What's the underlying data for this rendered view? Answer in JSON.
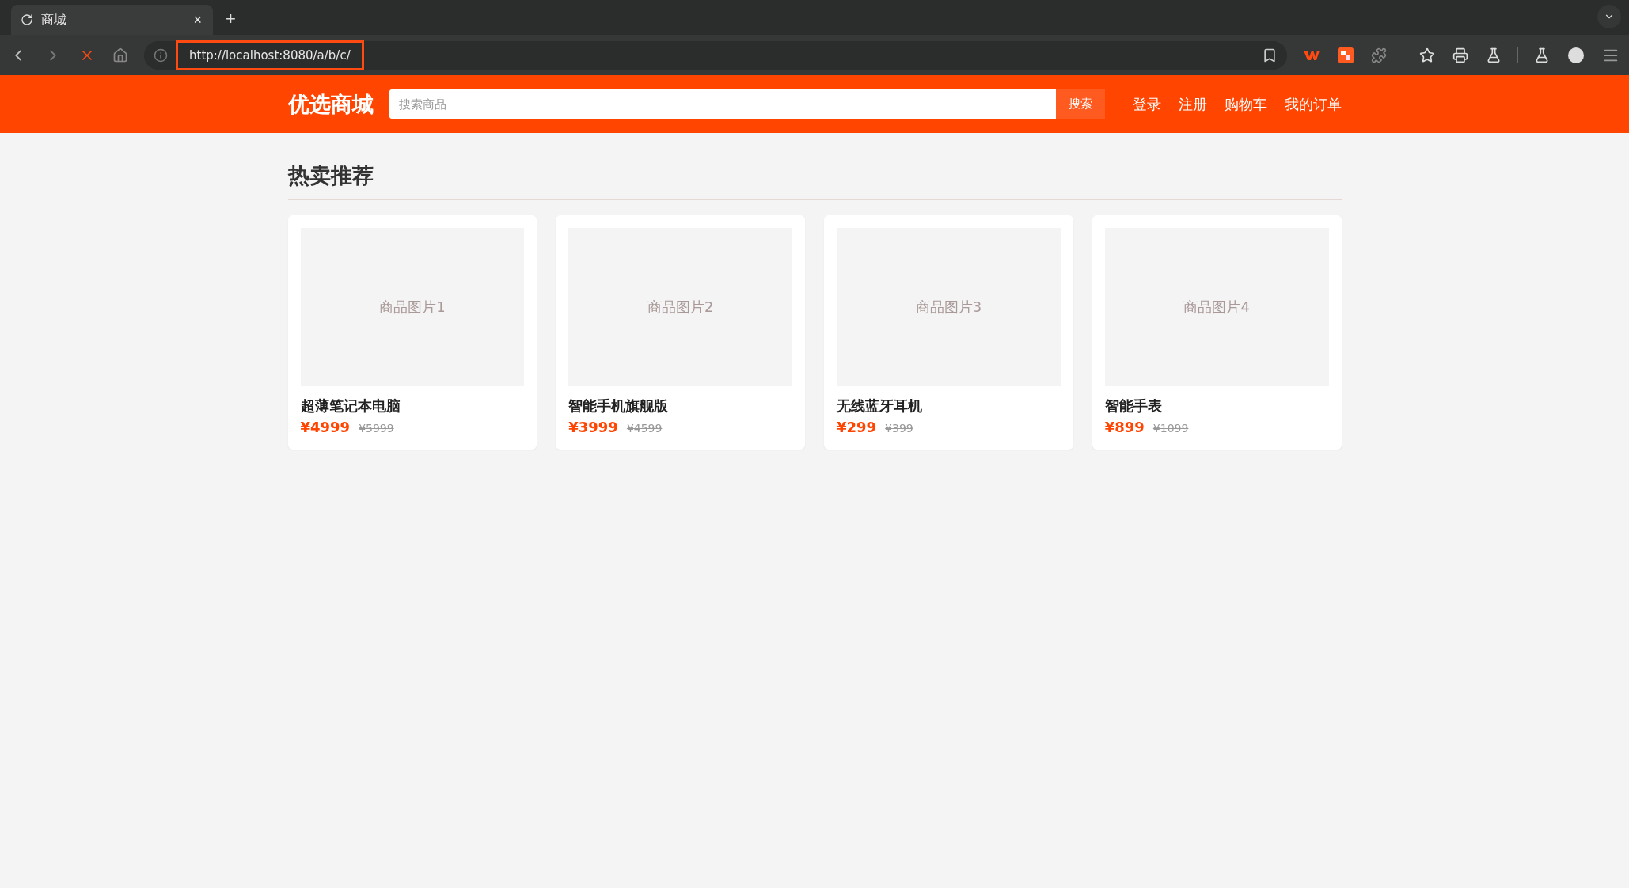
{
  "browser": {
    "tabs": [
      {
        "title": "商城",
        "selected": true,
        "loading": true
      }
    ],
    "new_tab": "+",
    "close": "×",
    "url": "http://localhost:8080/a/b/c/",
    "url_highlighted": true
  },
  "header": {
    "logo": "优选商城",
    "search": {
      "placeholder": "搜索商品",
      "button": "搜索"
    },
    "nav_links": [
      "登录",
      "注册",
      "购物车",
      "我的订单"
    ]
  },
  "section": {
    "title": "热卖推荐"
  },
  "products": [
    {
      "image_label": "商品图片1",
      "name": "超薄笔记本电脑",
      "price": "¥4999",
      "original_price": "¥5999"
    },
    {
      "image_label": "商品图片2",
      "name": "智能手机旗舰版",
      "price": "¥3999",
      "original_price": "¥4599"
    },
    {
      "image_label": "商品图片3",
      "name": "无线蓝牙耳机",
      "price": "¥299",
      "original_price": "¥399"
    },
    {
      "image_label": "商品图片4",
      "name": "智能手表",
      "price": "¥899",
      "original_price": "¥1099"
    }
  ]
}
